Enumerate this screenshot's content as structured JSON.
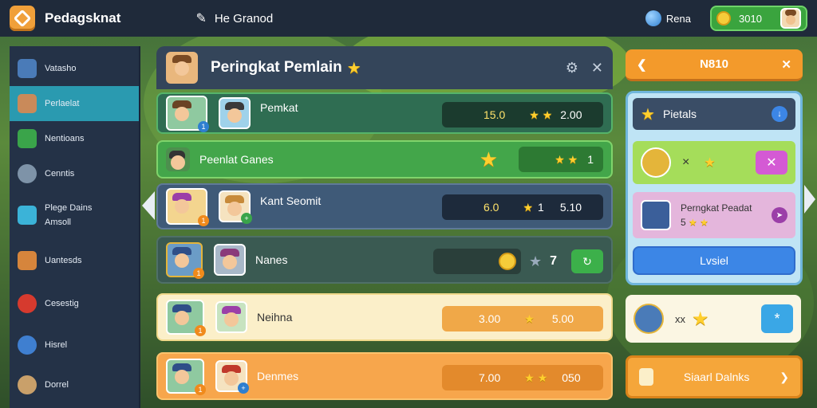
{
  "app": {
    "title": "Pedagsknat",
    "edit_label": "He Granod"
  },
  "topbar": {
    "user_label": "Rena",
    "coins": "3010",
    "icons": [
      "globe-icon",
      "coin-icon",
      "edit-icon"
    ]
  },
  "sidebar": {
    "items": [
      {
        "label": "Vatasho",
        "color": "#4a7bb8"
      },
      {
        "label": "Perlaelat",
        "color": "#c98a5a",
        "active": true
      },
      {
        "label": "Nentioans",
        "color": "#3aa44a"
      },
      {
        "label": "Cenntis",
        "color": "#7e93a8"
      },
      {
        "label": "Plege Dains",
        "label2": "Amsoll",
        "color": "#3bb3d8"
      },
      {
        "label": "Uantesds",
        "color": "#d6853c"
      },
      {
        "label": "Cesestig",
        "color": "#d63a2e"
      },
      {
        "label": "Hisrel",
        "color": "#3f7fd0"
      },
      {
        "label": "Dorrel",
        "color": "#c9a06a"
      }
    ]
  },
  "panel": {
    "title": "Peringkat Pemlain",
    "icons": [
      "star-icon",
      "gear-icon",
      "close-icon"
    ],
    "rows": [
      {
        "name": "Pemkat",
        "score": "15.0",
        "right": "2.00",
        "bg": "#2f6d52",
        "pill": "#1b3b2e"
      },
      {
        "name": "Peenlat Ganes",
        "score": "",
        "right": "1",
        "bg": "#43a64a",
        "pill": "#2d7a33"
      },
      {
        "name": "Kant Seomit",
        "score": "6.0",
        "mid": "1",
        "right": "5.10",
        "bg": "#3f5a78",
        "pill": "#1d2a3b"
      },
      {
        "name": "Nanes",
        "score": "7",
        "bg": "#3a5a52",
        "pill": "#2a3f3a"
      },
      {
        "name": "Neihna",
        "score": "3.00",
        "right": "5.00",
        "bg": "#fbefc9",
        "pill": "#f0a848"
      },
      {
        "name": "Denmes",
        "score": "7.00",
        "right": "050",
        "bg": "#f7a64c",
        "pill": "#e38a2c"
      }
    ]
  },
  "right": {
    "orange_label": "N810",
    "panel_title": "Pietals",
    "card2_title": "Perngkat Peadat",
    "card2_sub": "5",
    "button_label": "Lvsiel",
    "white_label": "xx",
    "bottom_label": "Siaarl Dalnks"
  }
}
